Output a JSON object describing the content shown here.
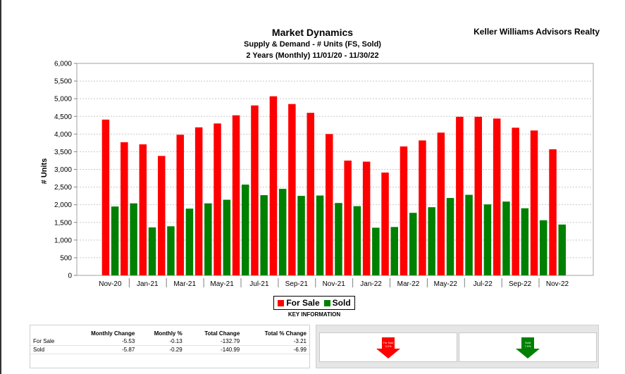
{
  "header": {
    "title": "Market Dynamics",
    "subtitle": "Supply & Demand - # Units (FS, Sold)",
    "period": "2 Years (Monthly) 11/01/20 - 11/30/22",
    "company": "Keller Williams Advisors Realty"
  },
  "chart_data": {
    "type": "bar",
    "ylabel": "# Units",
    "ylim": [
      0,
      6000
    ],
    "yticks": [
      "0",
      "500",
      "1,000",
      "1,500",
      "2,000",
      "2,500",
      "3,000",
      "3,500",
      "4,000",
      "4,500",
      "5,000",
      "5,500",
      "6,000"
    ],
    "xtick_labels": [
      "Nov-20",
      "Jan-21",
      "Mar-21",
      "May-21",
      "Jul-21",
      "Sep-21",
      "Nov-21",
      "Jan-22",
      "Mar-22",
      "May-22",
      "Jul-22",
      "Sep-22",
      "Nov-22"
    ],
    "grid": true,
    "legend_position": "bottom",
    "colors": {
      "for_sale": "#ff0000",
      "sold": "#008000"
    },
    "series": [
      {
        "name": "For Sale",
        "values": [
          4410,
          3770,
          3710,
          3380,
          3980,
          4190,
          4300,
          4530,
          4810,
          5070,
          4850,
          4600,
          4000,
          3250,
          3220,
          2910,
          3650,
          3820,
          4040,
          4490,
          4490,
          4440,
          4180,
          4100,
          3570
        ]
      },
      {
        "name": "Sold",
        "values": [
          1950,
          2040,
          1360,
          1390,
          1890,
          2040,
          2140,
          2570,
          2270,
          2450,
          2250,
          2260,
          2050,
          1960,
          1350,
          1370,
          1770,
          1930,
          2190,
          2280,
          2010,
          2090,
          1900,
          1560,
          1440
        ]
      }
    ]
  },
  "legend": {
    "for_sale": "For Sale",
    "sold": "Sold",
    "caption": "KEY INFORMATION"
  },
  "stats": {
    "headers": [
      "Monthly Change",
      "Monthly %",
      "Total Change",
      "Total % Change"
    ],
    "rows": [
      {
        "label": "For Sale",
        "values": [
          "-5.53",
          "-0.13",
          "-132.79",
          "-3.21"
        ]
      },
      {
        "label": "Sold",
        "values": [
          "-5.87",
          "-0.29",
          "-140.99",
          "-6.99"
        ]
      }
    ]
  },
  "indicators": {
    "for_sale": {
      "label": "For Sale",
      "value": "3.2%",
      "color": "#ff0000"
    },
    "sold": {
      "label": "Sold",
      "value": "7.0%",
      "color": "#008000"
    }
  }
}
